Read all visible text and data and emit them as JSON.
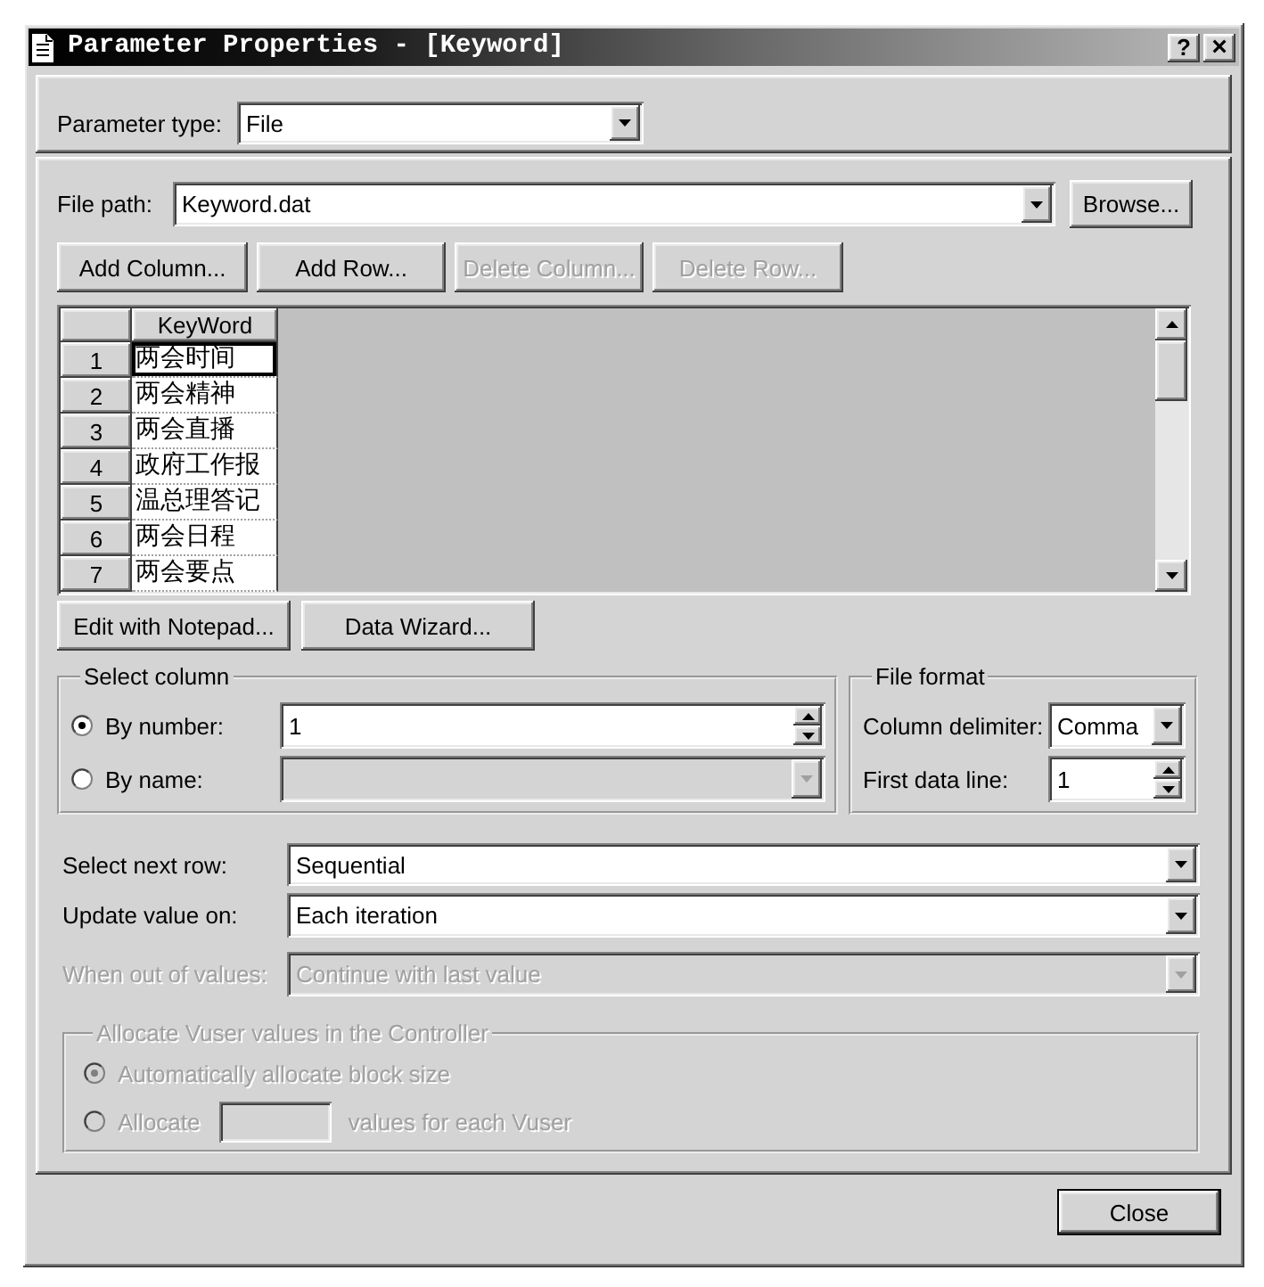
{
  "window": {
    "title": "Parameter Properties - [Keyword]",
    "title_buttons": [
      {
        "kind": "help",
        "label": "?"
      },
      {
        "kind": "close",
        "label": "×"
      }
    ]
  },
  "parameter_type": {
    "label": "Parameter type:",
    "value": "File"
  },
  "file_path": {
    "label": "File path:",
    "value": "Keyword.dat",
    "browse_button": "Browse..."
  },
  "grid_buttons": [
    {
      "label": "Add Column...",
      "disabled": false
    },
    {
      "label": "Add Row...",
      "disabled": false
    },
    {
      "label": "Delete Column...",
      "disabled": true
    },
    {
      "label": "Delete Row...",
      "disabled": true
    }
  ],
  "grid": {
    "columns": [
      "KeyWord"
    ],
    "rows": [
      {
        "number": "1",
        "cells": [
          "两会时间"
        ],
        "selected": true
      },
      {
        "number": "2",
        "cells": [
          "两会精神"
        ],
        "selected": false
      },
      {
        "number": "3",
        "cells": [
          "两会直播"
        ],
        "selected": false
      },
      {
        "number": "4",
        "cells": [
          "政府工作报"
        ],
        "selected": false
      },
      {
        "number": "5",
        "cells": [
          "温总理答记"
        ],
        "selected": false
      },
      {
        "number": "6",
        "cells": [
          "两会日程"
        ],
        "selected": false
      },
      {
        "number": "7",
        "cells": [
          "两会要点"
        ],
        "selected": false
      }
    ]
  },
  "data_buttons": [
    "Edit with Notepad...",
    "Data Wizard..."
  ],
  "select_column": {
    "title": "Select column",
    "options": [
      {
        "label": "By number:",
        "selected": true,
        "field": {
          "kind": "spin",
          "value": "1",
          "disabled": false
        }
      },
      {
        "label": "By name:",
        "selected": false,
        "field": {
          "kind": "combo",
          "disabled": true
        }
      }
    ]
  },
  "file_format": {
    "title": "File format",
    "fields": [
      {
        "label": "Column delimiter:",
        "kind": "combo",
        "value": "Comma"
      },
      {
        "label": "First data line:",
        "kind": "spin",
        "value": "1"
      }
    ]
  },
  "row_settings": [
    {
      "label": "Select next row:",
      "value": "Sequential",
      "disabled": false
    },
    {
      "label": "Update value on:",
      "value": "Each iteration",
      "disabled": false
    },
    {
      "label": "When out of values:",
      "value": "Continue with last value",
      "disabled": true
    }
  ],
  "allocate": {
    "title": "Allocate Vuser values in the Controller",
    "disabled": true,
    "options": [
      {
        "kind": "plain",
        "label": "Automatically allocate block size",
        "selected": true
      },
      {
        "kind": "count",
        "label": "Allocate",
        "suffix": "values for each Vuser",
        "selected": false
      }
    ]
  },
  "close_button": "Close"
}
